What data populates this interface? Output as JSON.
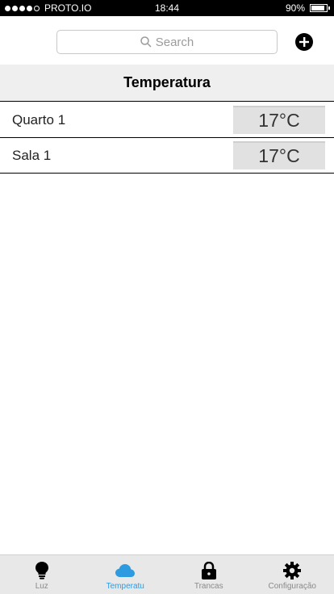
{
  "status_bar": {
    "carrier": "PROTO.IO",
    "time": "18:44",
    "battery": "90%",
    "battery_level": 0.9,
    "signal_bars_filled": 4,
    "signal_bars_total": 5
  },
  "search": {
    "placeholder": "Search"
  },
  "add_icon": "plus-circle-icon",
  "section": {
    "title": "Temperatura"
  },
  "rooms": [
    {
      "name": "Quarto 1",
      "temperature": "17°C"
    },
    {
      "name": "Sala 1",
      "temperature": "17°C"
    }
  ],
  "tabs": [
    {
      "label": "Luz",
      "icon": "lightbulb-icon",
      "active": false
    },
    {
      "label": "Temperatu",
      "icon": "cloud-icon",
      "active": true
    },
    {
      "label": "Trancas",
      "icon": "lock-icon",
      "active": false
    },
    {
      "label": "Configuração",
      "icon": "gear-icon",
      "active": false
    }
  ],
  "colors": {
    "accent": "#2e9be0",
    "inactive_tab": "#8a8a8a",
    "header_bg": "#efefef",
    "temp_bg": "#e1e1e1"
  }
}
